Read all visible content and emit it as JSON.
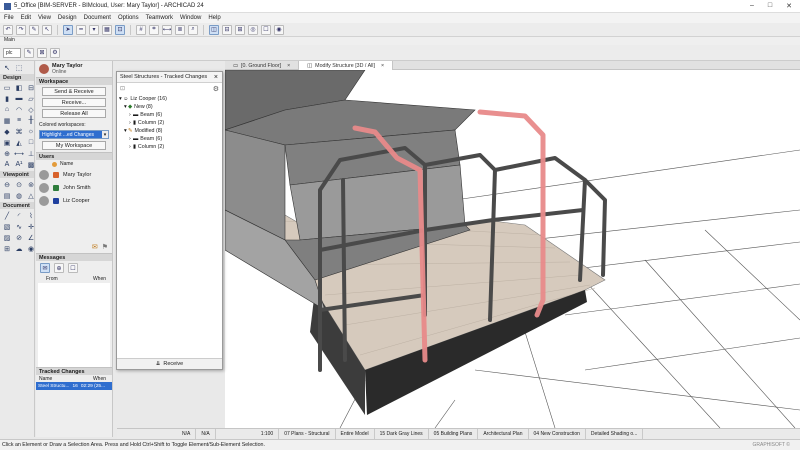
{
  "window": {
    "title": "5_Office [BIM-SERVER - BIMcloud, User: Mary Taylor] - ARCHICAD 24",
    "controls": [
      "–",
      "□",
      "✕"
    ]
  },
  "menu": [
    "File",
    "Edit",
    "View",
    "Design",
    "Document",
    "Options",
    "Teamwork",
    "Window",
    "Help"
  ],
  "toolbar3": {
    "dropdown_value": "plc"
  },
  "toolbox": {
    "sections": [
      "Design",
      "Viewpoint",
      "Document"
    ],
    "label_main": "Main"
  },
  "teamwork": {
    "user_name": "Mary Taylor",
    "online_label": "Online",
    "workspace_header": "Workspace",
    "send_receive": "Send & Receive",
    "receive": "Receive...",
    "release_all": "Release All",
    "colored_workspaces_label": "Colored workspaces:",
    "colored_workspaces_value": "Highlight ...ed Changes",
    "my_workspace": "My Workspace",
    "users_header": "Users",
    "users_column": "Name",
    "users": [
      {
        "name": "Mary Taylor",
        "color": "#d8622b"
      },
      {
        "name": "John Smith",
        "color": "#2e7d3c"
      },
      {
        "name": "Liz Cooper",
        "color": "#1f3f9e"
      }
    ],
    "messages_header": "Messages",
    "messages_cols": [
      "From",
      "When"
    ],
    "tracked_header": "Tracked Changes",
    "tracked_cols": [
      "Name",
      "When"
    ],
    "tracked_row": {
      "name": "Steel Structu...",
      "count": "16",
      "when": "02:29 (25..."
    }
  },
  "tracked_dialog": {
    "title": "Steel Structures - Tracked Changes",
    "tree": [
      {
        "label": "Liz Cooper (16)",
        "indent": 0
      },
      {
        "label": "New (8)",
        "indent": 1
      },
      {
        "label": "Beam (6)",
        "indent": 2
      },
      {
        "label": "Column (2)",
        "indent": 2
      },
      {
        "label": "Modified (8)",
        "indent": 1
      },
      {
        "label": "Beam (6)",
        "indent": 2
      },
      {
        "label": "Column (2)",
        "indent": 2
      }
    ],
    "receive_button": "Receive"
  },
  "tabs": [
    {
      "label": "[0. Ground Floor]",
      "active": false
    },
    {
      "label": "Modify Structure [3D / All]",
      "active": true
    }
  ],
  "statusnav": [
    "N/A",
    "N/A",
    "1:100",
    "07 Plans - Structural",
    "Entire Model",
    "15 Dark Gray Lines",
    "05 Building Plans",
    "Architectural Plan",
    "04 New Construction",
    "Detailed Shading o..."
  ],
  "statusbar": {
    "message": "Click an Element or Draw a Selection Area. Press and Hold Ctrl+Shift to Toggle Element/Sub-Element Selection.",
    "brand": "GRAPHISOFT ©"
  },
  "colors": {
    "highlight": "#e88a8a",
    "steel": "#5a5a5a",
    "floor": "#8a8a8a",
    "deck": "#d9cfc2"
  }
}
